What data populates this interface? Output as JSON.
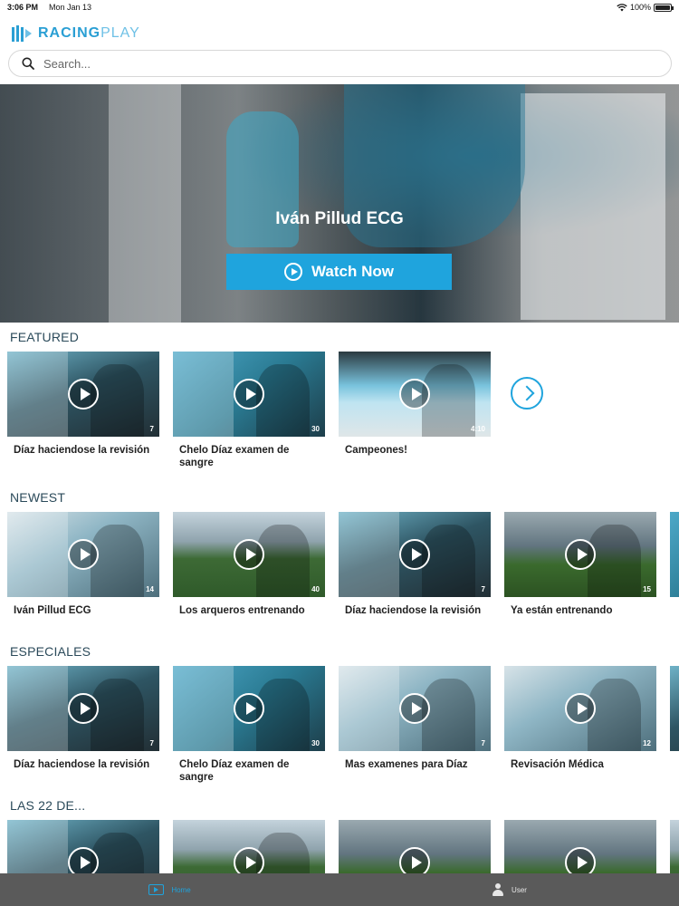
{
  "status_bar": {
    "time": "3:06 PM",
    "date": "Mon Jan 13",
    "battery": "100%",
    "battery_level": 1.0
  },
  "header": {
    "brand_part1": "RACING",
    "brand_part2": "PLAY",
    "logo_icon": "racingplay-logo-icon"
  },
  "search": {
    "placeholder": "Search...",
    "value": "",
    "icon": "search-icon"
  },
  "hero": {
    "title": "Iván Pillud ECG",
    "button_label": "Watch Now",
    "button_icon": "play-circle-icon"
  },
  "sections": {
    "featured": {
      "title": "FEATURED",
      "items": [
        {
          "title": "Díaz haciendose la revisión",
          "duration": "7"
        },
        {
          "title": "Chelo Díaz examen de sangre",
          "duration": "30"
        },
        {
          "title": "Campeones!",
          "duration": "4:10"
        }
      ]
    },
    "newest": {
      "title": "NEWEST",
      "items": [
        {
          "title": "Iván Pillud ECG",
          "duration": "14"
        },
        {
          "title": "Los arqueros entrenando",
          "duration": "40"
        },
        {
          "title": "Díaz haciendose la revisión",
          "duration": "7"
        },
        {
          "title": "Ya están entrenando",
          "duration": "15"
        }
      ]
    },
    "especiales": {
      "title": "ESPECIALES",
      "items": [
        {
          "title": "Díaz haciendose la revisión",
          "duration": "7"
        },
        {
          "title": "Chelo Díaz examen de sangre",
          "duration": "30"
        },
        {
          "title": "Mas examenes para Díaz",
          "duration": "7"
        },
        {
          "title": "Revisación Médica",
          "duration": "12"
        }
      ]
    },
    "las22": {
      "title": "LAS 22 DE...",
      "items": [
        {
          "title": "",
          "duration": ""
        },
        {
          "title": "",
          "duration": ""
        },
        {
          "title": "",
          "duration": ""
        },
        {
          "title": "",
          "duration": ""
        }
      ]
    }
  },
  "tab_bar": {
    "tabs": [
      {
        "label": "Home",
        "icon": "tv-play-icon",
        "active": true
      },
      {
        "label": "User",
        "icon": "user-icon",
        "active": false
      }
    ]
  },
  "colors": {
    "accent": "#1fa4dd",
    "tab_bar_bg": "#5a5a5a",
    "section_title": "#2b4a5a"
  }
}
